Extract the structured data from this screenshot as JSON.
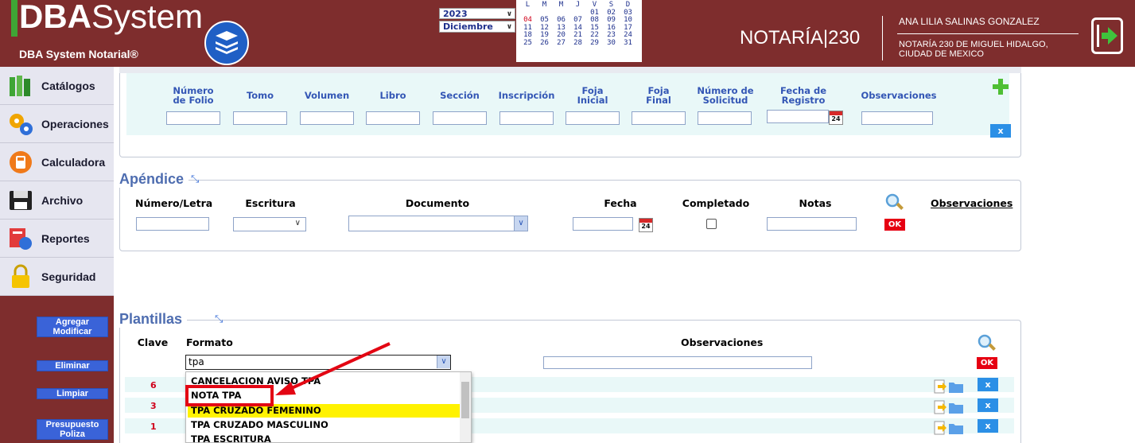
{
  "header": {
    "logo_bold": "DBA",
    "logo_light": "System",
    "logo_sub": "DBA System Notarial®",
    "year": "2023",
    "month": "Diciembre",
    "weekdays": [
      "L",
      "M",
      "M",
      "J",
      "V",
      "S",
      "D"
    ],
    "cal_rows": [
      [
        "",
        "",
        "",
        "",
        "01",
        "02",
        "03"
      ],
      [
        "04",
        "05",
        "06",
        "07",
        "08",
        "09",
        "10"
      ],
      [
        "11",
        "12",
        "13",
        "14",
        "15",
        "16",
        "17"
      ],
      [
        "18",
        "19",
        "20",
        "21",
        "22",
        "23",
        "24"
      ],
      [
        "25",
        "26",
        "27",
        "28",
        "29",
        "30",
        "31"
      ]
    ],
    "today": "04",
    "notaria": "NOTARÍA|230",
    "user": "ANA LILIA SALINAS GONZALEZ",
    "notaria_line1": "NOTARÍA 230 DE MIGUEL HIDALGO,",
    "notaria_line2": "CIUDAD DE MEXICO"
  },
  "sidebar": {
    "items": [
      {
        "label": "Catálogos"
      },
      {
        "label": "Operaciones"
      },
      {
        "label": "Calculadora"
      },
      {
        "label": "Archivo"
      },
      {
        "label": "Reportes"
      },
      {
        "label": "Seguridad"
      }
    ],
    "btn_agregar": "Agregar",
    "btn_modificar": "Modificar",
    "btn_eliminar": "Eliminar",
    "btn_limpiar": "Limpiar",
    "btn_presupuesto": "Presupuesto",
    "btn_poliza": "Poliza"
  },
  "folio": {
    "h1a": "Número",
    "h1b": "de Folio",
    "h2": "Tomo",
    "h3": "Volumen",
    "h4": "Libro",
    "h5": "Sección",
    "h6": "Inscripción",
    "h7a": "Foja",
    "h7b": "Inicial",
    "h8a": "Foja",
    "h8b": "Final",
    "h9a": "Número de",
    "h9b": "Solicitud",
    "h10a": "Fecha de",
    "h10b": "Registro",
    "h11": "Observaciones",
    "x": "x",
    "cal": "24"
  },
  "apendice": {
    "title": "Apéndice",
    "h_num": "Número/Letra",
    "h_esc": "Escritura",
    "h_doc": "Documento",
    "h_fecha": "Fecha",
    "h_comp": "Completado",
    "h_notas": "Notas",
    "h_obs": "Observaciones",
    "ok": "OK",
    "cal": "24"
  },
  "plantillas": {
    "title": "Plantillas",
    "h_clave": "Clave",
    "h_formato": "Formato",
    "h_obs": "Observaciones",
    "formato_value": "tpa",
    "ok": "OK",
    "x": "x",
    "rows": [
      {
        "clave": "6"
      },
      {
        "clave": "3"
      },
      {
        "clave": "1"
      }
    ],
    "options": [
      "CANCELACION AVISO TPA",
      "NOTA TPA",
      "TPA CRUZADO FEMENINO",
      "TPA CRUZADO MASCULINO",
      "TPA ESCRITURA"
    ]
  },
  "colors": {
    "header_bg": "#7e2d2d",
    "accent_blue": "#3356b5",
    "ok_red": "#e60012",
    "x_blue": "#2b8fe6",
    "highlight": "#fff200",
    "annotation_red": "#e30613"
  }
}
